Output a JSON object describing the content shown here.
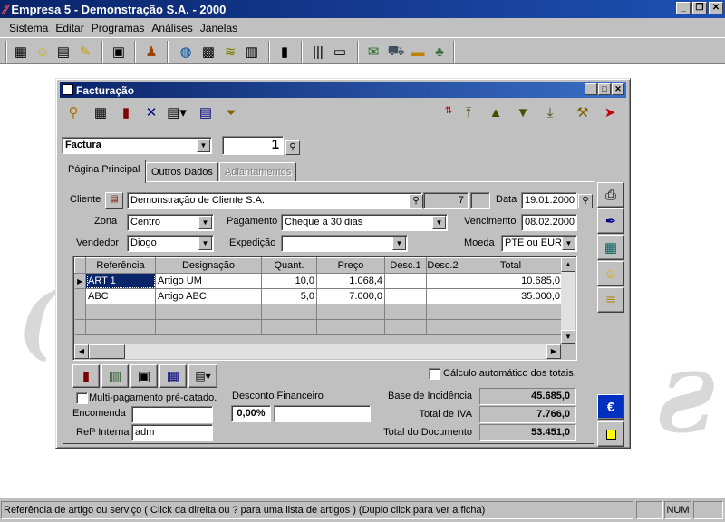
{
  "app": {
    "title": "Empresa 5 - Demonstração S.A. - 2000",
    "menu": [
      "Sistema",
      "Editar",
      "Programas",
      "Análises",
      "Janelas"
    ]
  },
  "toolbar_icons": [
    "calculator-icon",
    "smiley-icon",
    "document-icon",
    "note-icon",
    "notepad-icon",
    "user-icon",
    "globe-icon",
    "calendar-icon",
    "money-stack-icon",
    "printer-stack-icon",
    "book-icon",
    "barcode-icon",
    "screen-icon",
    "cheque-icon",
    "car-icon",
    "card-icon",
    "tree-icon"
  ],
  "child": {
    "title": "Facturação",
    "doc_type": "Factura",
    "doc_number": "1",
    "tabs": [
      {
        "label": "Página Principal",
        "state": "active"
      },
      {
        "label": "Outros Dados",
        "state": "normal"
      },
      {
        "label": "Adiantamentos",
        "state": "disabled"
      }
    ],
    "form": {
      "cliente_label": "Cliente",
      "cliente_value": "Demonstração de Cliente S.A.",
      "cliente_code": "7",
      "data_label": "Data",
      "data_value": "19.01.2000",
      "zona_label": "Zona",
      "zona_value": "Centro",
      "pagamento_label": "Pagamento",
      "pagamento_value": "Cheque a 30 dias",
      "vencimento_label": "Vencimento",
      "vencimento_value": "08.02.2000",
      "vendedor_label": "Vendedor",
      "vendedor_value": "Diogo",
      "expedicao_label": "Expedição",
      "expedicao_value": "",
      "moeda_label": "Moeda",
      "moeda_value": "PTE ou EURO"
    },
    "grid": {
      "columns": [
        "Referência",
        "Designação",
        "Quant.",
        "Preço",
        "Desc.1",
        "Desc.2",
        "Total"
      ],
      "rows": [
        [
          "ART 1",
          "Artigo UM",
          "10,0",
          "1.068,4",
          "",
          "",
          "10.685,0"
        ],
        [
          "ABC",
          "Artigo ABC",
          "5,0",
          "7.000,0",
          "",
          "",
          "35.000,0"
        ]
      ]
    },
    "footer": {
      "auto_calc_label": "Cálculo automático dos totais.",
      "multi_pag_label": "Multi-pagamento pré-datado.",
      "encomenda_label": "Encomenda",
      "encomenda_value": "",
      "ref_interna_label": "Refª Interna",
      "ref_interna_value": "adm",
      "desconto_label": "Desconto Financeiro",
      "desconto_pct": "0,00%",
      "desconto_value": "",
      "base_label": "Base de Incidência",
      "base_value": "45.685,0",
      "iva_label": "Total de IVA",
      "iva_value": "7.766,0",
      "doc_total_label": "Total do Documento",
      "doc_total_value": "53.451,0"
    }
  },
  "status": {
    "text": "Referência de artigo ou serviço ( Click da direita ou ? para uma lista de artigos ) (Duplo click para ver a ficha)",
    "num": "NUM"
  }
}
